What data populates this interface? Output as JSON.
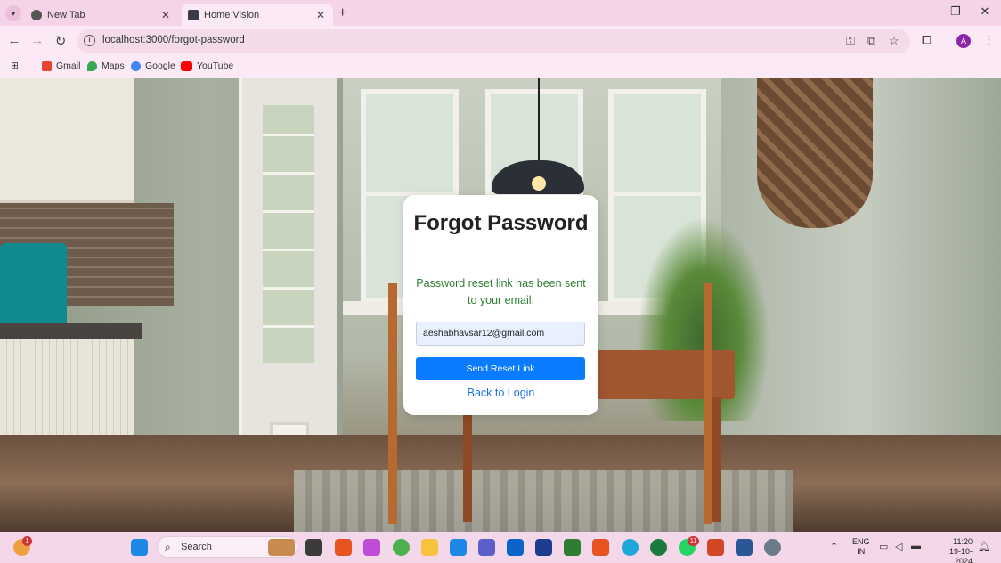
{
  "browser": {
    "tabs": [
      {
        "label": "New Tab",
        "active": false
      },
      {
        "label": "Home Vision",
        "active": true
      }
    ],
    "new_tab_icon": "+",
    "url": "localhost:3000/forgot-password",
    "profile_initial": "A",
    "bookmarks": [
      {
        "label": "Gmail",
        "icon": "gmail-icon",
        "color": "#ea4335"
      },
      {
        "label": "Maps",
        "icon": "maps-icon",
        "color": "#34a853"
      },
      {
        "label": "Google",
        "icon": "google-icon",
        "color": "#4285f4"
      },
      {
        "label": "YouTube",
        "icon": "youtube-icon",
        "color": "#ff0000"
      }
    ]
  },
  "form": {
    "title": "Forgot Password",
    "success_message": "Password reset link has been sent to your email.",
    "email_value": "aeshabhavsar12@gmail.com",
    "submit_label": "Send Reset Link",
    "back_link": "Back to Login"
  },
  "colors": {
    "success": "#2e7d32",
    "primary_button": "#0b7cff",
    "link": "#1a73e8"
  },
  "taskbar": {
    "search_placeholder": "Search",
    "weather_badge": "1",
    "whatsapp_badge": "11",
    "language_line1": "ENG",
    "language_line2": "IN",
    "time": "11:20",
    "date": "19-10-2024"
  }
}
